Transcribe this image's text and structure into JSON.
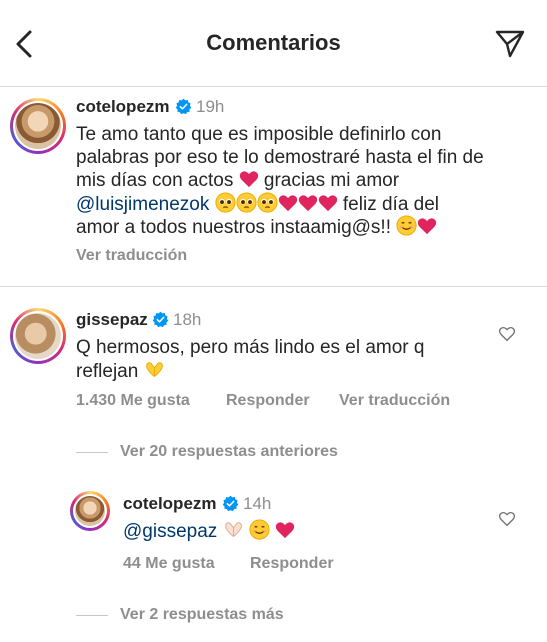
{
  "header": {
    "title": "Comentarios"
  },
  "post": {
    "username": "cotelopezm",
    "time": "19h",
    "line1": "Te amo tanto que es imposible definirlo con",
    "line2": "palabras por eso te lo demostraré hasta el fin de",
    "line3_a": "mis días con actos ",
    "line3_b": " gracias mi amor",
    "mention": "@luisjimenezok",
    "line4_b": " feliz día del",
    "line5": "amor a todos nuestros instaamig@s!! ",
    "see_translation": "Ver traducción"
  },
  "comment": {
    "username": "gissepaz",
    "time": "18h",
    "line1": "Q hermosos, pero más lindo es el amor q",
    "line2": "reflejan ",
    "likes": "1.430 Me gusta",
    "reply": "Responder",
    "see_translation": "Ver traducción"
  },
  "view_previous": "Ver 20 respuestas anteriores",
  "reply": {
    "username": "cotelopezm",
    "time": "14h",
    "mention": "@gissepaz",
    "likes": "44 Me gusta",
    "reply": "Responder"
  },
  "view_more": "Ver 2 respuestas más",
  "icons": {
    "back": "chevron-left-icon",
    "send": "paper-plane-icon",
    "verified": "verified-badge-icon",
    "like": "heart-outline-icon"
  },
  "colors": {
    "mention": "#00376b",
    "verified": "#0095f6",
    "heart": "#e0245e",
    "secondary_text": "#8e8e8e"
  }
}
